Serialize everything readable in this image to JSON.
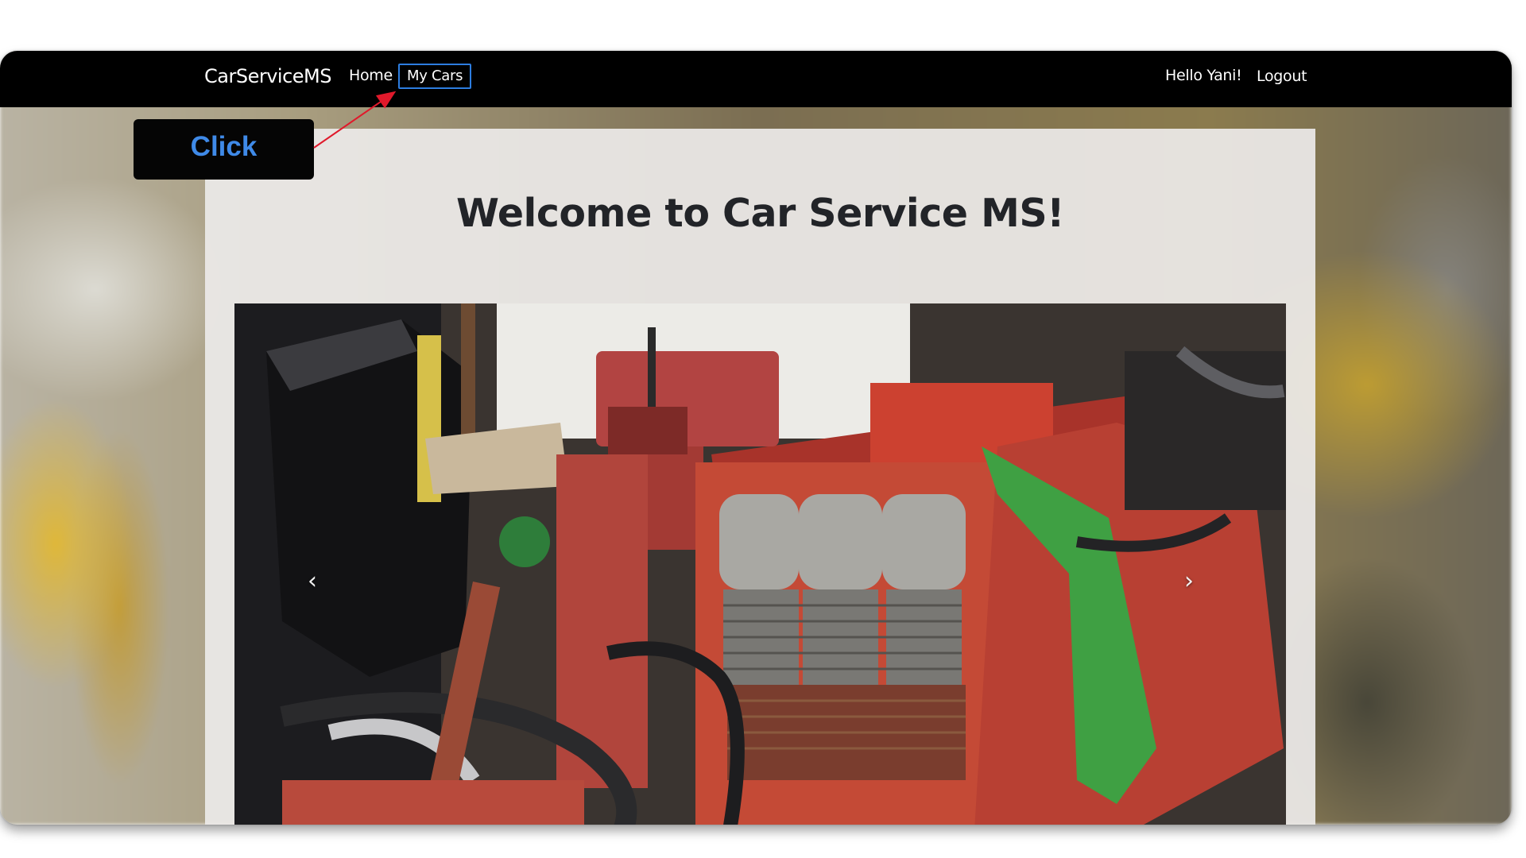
{
  "navbar": {
    "brand": "CarServiceMS",
    "home": "Home",
    "my_cars": "My Cars",
    "greeting": "Hello Yani!",
    "logout": "Logout"
  },
  "main": {
    "title": "Welcome to Car Service MS!",
    "carousel": {
      "prev_icon": "chevron-left-icon",
      "next_icon": "chevron-right-icon",
      "prev_symbol": "‹",
      "next_symbol": "›"
    }
  },
  "annotation": {
    "callout_text": "Click",
    "callout_color": "#3f8ae8",
    "arrow_color": "#e0192b"
  },
  "colors": {
    "navbar_bg": "#000000",
    "focus_outline": "#2d7de0",
    "title_text": "#222428"
  }
}
